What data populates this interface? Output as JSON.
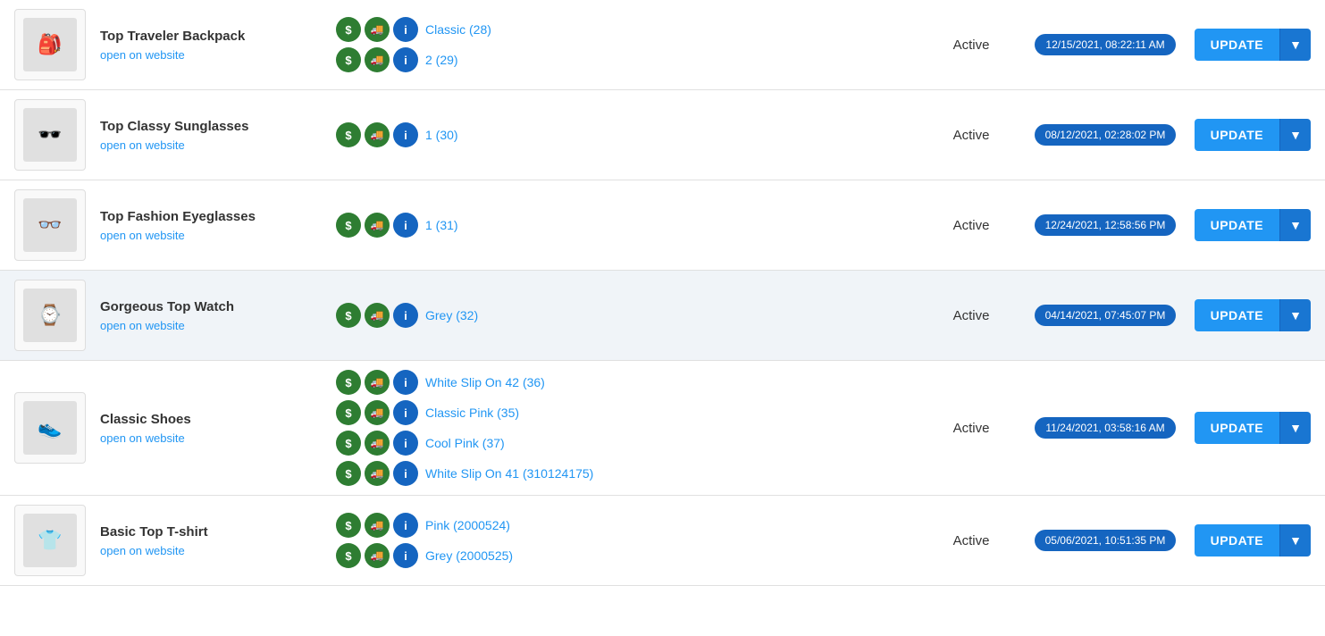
{
  "products": [
    {
      "id": "top-traveler-backpack",
      "name": "Top Traveler Backpack",
      "link": "open on website",
      "image_emoji": "🎒",
      "status": "Active",
      "date": "Active",
      "highlighted": false,
      "variants": [
        {
          "label": "Classic (28)"
        },
        {
          "label": "2 (29)"
        }
      ],
      "date_badge": "12/15/2021, 08:22:11 AM"
    },
    {
      "id": "top-classy-sunglasses",
      "name": "Top Classy Sunglasses",
      "link": "open on website",
      "image_emoji": "🕶️",
      "status": "Active",
      "highlighted": false,
      "variants": [
        {
          "label": "1 (30)"
        }
      ],
      "date_badge": "08/12/2021, 02:28:02 PM"
    },
    {
      "id": "top-fashion-eyeglasses",
      "name": "Top Fashion Eyeglasses",
      "link": "open on website",
      "image_emoji": "👓",
      "status": "Active",
      "highlighted": false,
      "variants": [
        {
          "label": "1 (31)"
        }
      ],
      "date_badge": "12/24/2021, 12:58:56 PM"
    },
    {
      "id": "gorgeous-top-watch",
      "name": "Gorgeous Top Watch",
      "link": "open on website",
      "image_emoji": "⌚",
      "status": "Active",
      "highlighted": true,
      "variants": [
        {
          "label": "Grey (32)"
        }
      ],
      "date_badge": "04/14/2021, 07:45:07 PM"
    },
    {
      "id": "classic-shoes",
      "name": "Classic Shoes",
      "link": "open on website",
      "image_emoji": "👟",
      "status": "Active",
      "highlighted": false,
      "variants": [
        {
          "label": "White Slip On 42 (36)"
        },
        {
          "label": "Classic Pink (35)"
        },
        {
          "label": "Cool Pink (37)"
        },
        {
          "label": "White Slip On 41 (310124175)"
        }
      ],
      "date_badge": "11/24/2021, 03:58:16 AM"
    },
    {
      "id": "basic-top-tshirt",
      "name": "Basic Top T-shirt",
      "link": "open on website",
      "image_emoji": "👕",
      "status": "Active",
      "highlighted": false,
      "variants": [
        {
          "label": "Pink (2000524)"
        },
        {
          "label": "Grey (2000525)"
        }
      ],
      "date_badge": "05/06/2021, 10:51:35 PM"
    }
  ],
  "buttons": {
    "update": "UPDATE"
  }
}
